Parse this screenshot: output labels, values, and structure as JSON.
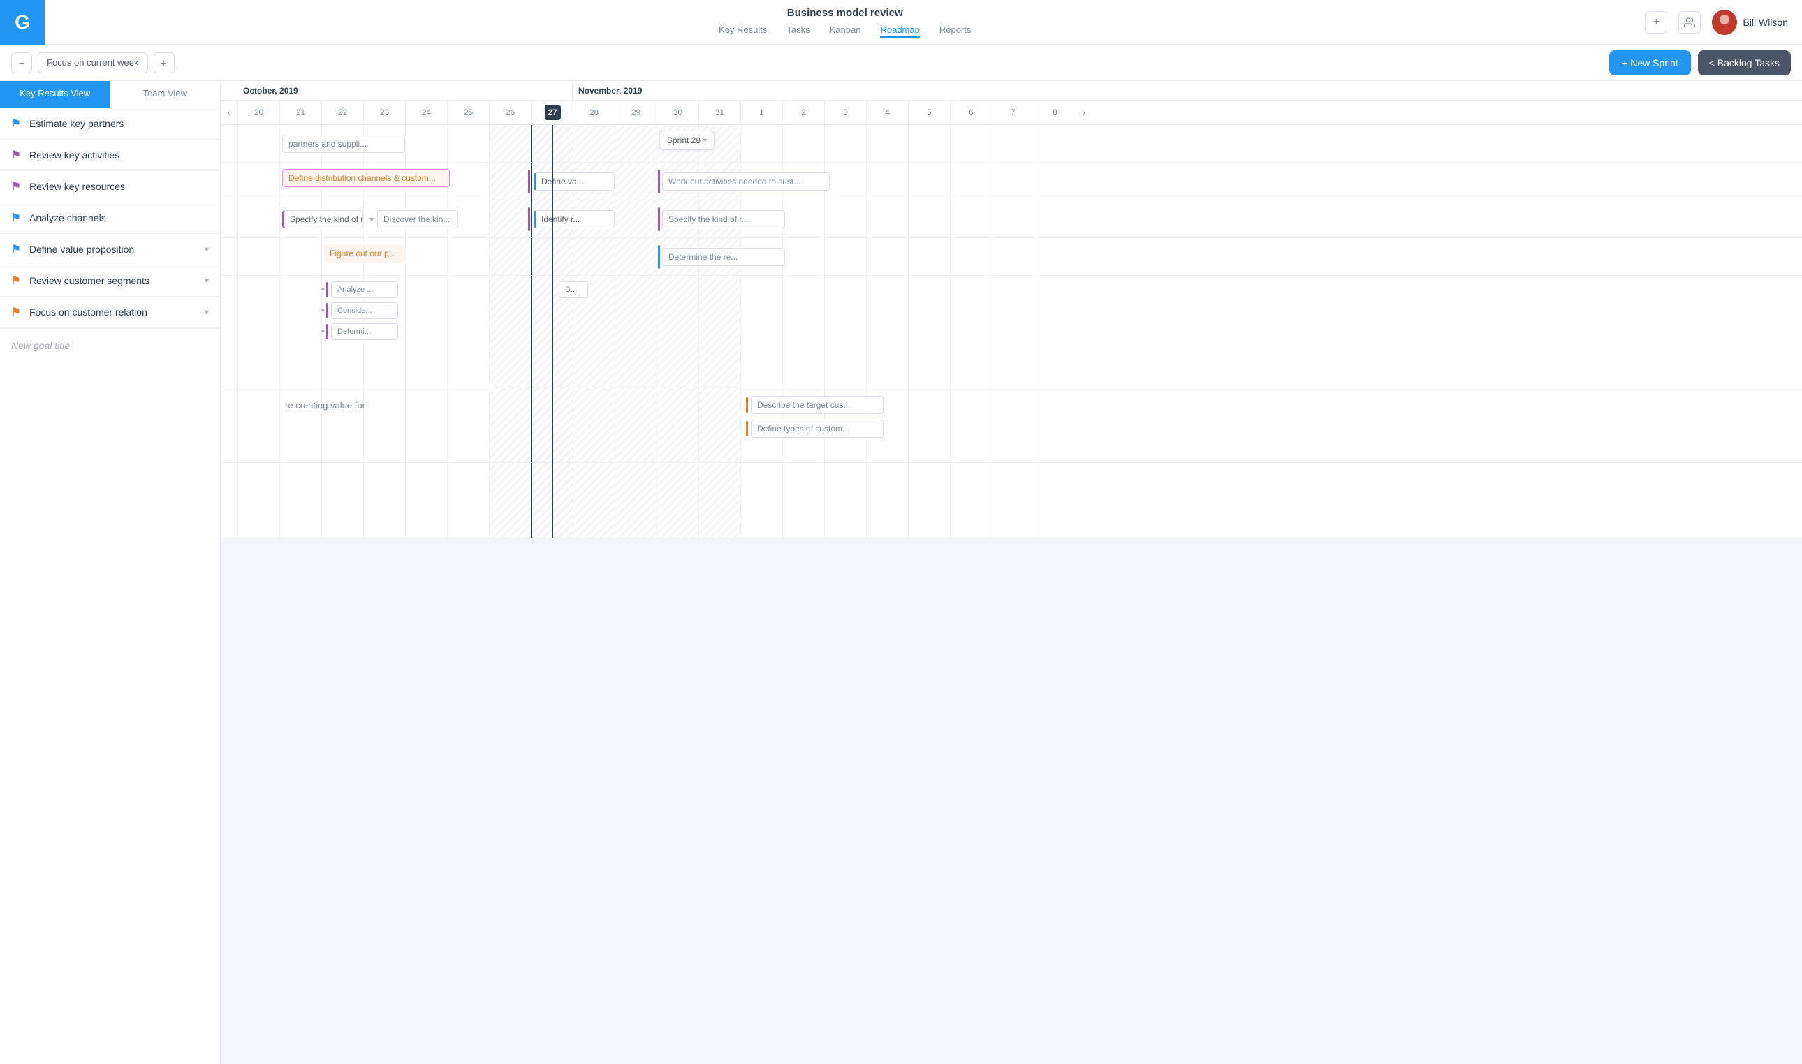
{
  "app": {
    "logo": "G",
    "project_title": "Business model review"
  },
  "nav": {
    "tabs": [
      {
        "label": "Key Results",
        "active": false
      },
      {
        "label": "Tasks",
        "active": false
      },
      {
        "label": "Kanban",
        "active": false
      },
      {
        "label": "Roadmap",
        "active": true
      },
      {
        "label": "Reports",
        "active": false
      }
    ]
  },
  "header": {
    "plus_icon": "+",
    "people_icon": "👥",
    "user_name": "Bill Wilson"
  },
  "toolbar": {
    "minus_label": "−",
    "focus_label": "Focus on current week",
    "plus_label": "+",
    "new_sprint_label": "+ New Sprint",
    "backlog_label": "< Backlog Tasks"
  },
  "sidebar": {
    "view_tabs": [
      {
        "label": "Key Results View",
        "active": true
      },
      {
        "label": "Team View",
        "active": false
      }
    ],
    "items": [
      {
        "label": "Estimate key partners",
        "flag": "blue",
        "has_chevron": false
      },
      {
        "label": "Review key activities",
        "flag": "purple",
        "has_chevron": false
      },
      {
        "label": "Review key resources",
        "flag": "purple",
        "has_chevron": false
      },
      {
        "label": "Analyze channels",
        "flag": "blue",
        "has_chevron": false
      },
      {
        "label": "Define value proposition",
        "flag": "blue",
        "has_chevron": true
      },
      {
        "label": "Review customer segments",
        "flag": "orange",
        "has_chevron": true
      },
      {
        "label": "Focus on customer relation",
        "flag": "orange",
        "has_chevron": true
      }
    ],
    "new_goal_placeholder": "New goal title"
  },
  "timeline": {
    "months": [
      {
        "label": "October, 2019",
        "cols": 8
      },
      {
        "label": "November, 2019",
        "cols": 8
      }
    ],
    "days": [
      20,
      21,
      22,
      23,
      24,
      25,
      26,
      27,
      28,
      29,
      30,
      31,
      1,
      2,
      3,
      4,
      5,
      6,
      7,
      8
    ],
    "today": 27,
    "sprint_label": "Sprint 28",
    "rows": [
      {
        "id": "row-partners",
        "tasks": [
          {
            "label": "partners and suppli...",
            "type": "outlined",
            "col_start": 2,
            "col_span": 3
          },
          {
            "label": "Sprint 28",
            "type": "sprint",
            "col_start": 11,
            "col_span": 4,
            "has_estimate": true
          }
        ]
      },
      {
        "id": "row-activities",
        "tasks": [
          {
            "label": "Define distribution channels & custom...",
            "type": "orange-text",
            "col_start": 2,
            "col_span": 4,
            "priority": true
          },
          {
            "label": "Define va...",
            "type": "blue-left",
            "col_start": 7,
            "col_span": 2
          },
          {
            "label": "Work out activities needed to sust...",
            "type": "outlined",
            "col_start": 11,
            "col_span": 4
          }
        ]
      },
      {
        "id": "row-resources",
        "tasks": [
          {
            "label": "Specify the kind of ro...",
            "type": "purple-left-outlined",
            "col_start": 2,
            "col_span": 2
          },
          {
            "label": "Discover the kin...",
            "type": "outlined",
            "col_start": 4,
            "col_span": 2
          },
          {
            "label": "Identify r...",
            "type": "blue-left",
            "col_start": 7,
            "col_span": 2
          },
          {
            "label": "Specify the kind of r...",
            "type": "outlined",
            "col_start": 11,
            "col_span": 3
          }
        ]
      },
      {
        "id": "row-channels",
        "tasks": [
          {
            "label": "Figure out our p...",
            "type": "orange-text",
            "col_start": 3,
            "col_span": 2,
            "priority": true
          },
          {
            "label": "Determine the re...",
            "type": "outlined",
            "col_start": 11,
            "col_span": 3
          }
        ]
      },
      {
        "id": "row-value-prop",
        "tasks": [
          {
            "label": "Analyze ...",
            "type": "subtask-outlined",
            "col_start": 3,
            "col_span": 2
          },
          {
            "label": "Conside...",
            "type": "subtask-outlined",
            "col_start": 3,
            "col_span": 2
          },
          {
            "label": "Determi...",
            "type": "subtask-outlined",
            "col_start": 3,
            "col_span": 2
          },
          {
            "label": "D...",
            "type": "outlined",
            "col_start": 11,
            "col_span": 1
          }
        ]
      },
      {
        "id": "row-customer-seg",
        "tasks": [
          {
            "label": "re creating value for",
            "type": "text-only",
            "col_start": 2,
            "col_span": 3
          },
          {
            "label": "Describe the target cus...",
            "type": "orange-left",
            "col_start": 13,
            "col_span": 3
          },
          {
            "label": "Define types of custom...",
            "type": "orange-left",
            "col_start": 13,
            "col_span": 3
          }
        ]
      },
      {
        "id": "row-customer-rel",
        "tasks": []
      }
    ]
  }
}
